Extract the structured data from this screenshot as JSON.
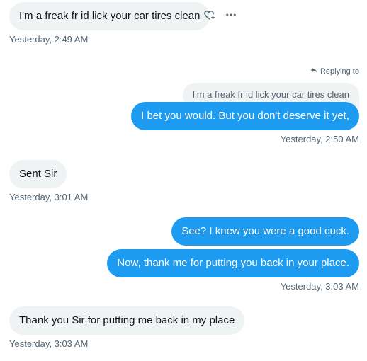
{
  "messages": [
    {
      "text": "I'm a freak fr id lick your car tires clean",
      "time": "Yesterday, 2:49 AM"
    },
    {
      "replying_label": "Replying to",
      "quoted": "I'm a freak fr id lick your car tires clean",
      "text": "I bet you would. But you don't deserve it yet,",
      "time": "Yesterday, 2:50 AM"
    },
    {
      "text": "Sent Sir",
      "time": "Yesterday, 3:01 AM"
    },
    {
      "text": "See? I knew you were a good cuck.",
      "time": ""
    },
    {
      "text": "Now, thank me for putting you back in your place.",
      "time": "Yesterday, 3:03 AM"
    },
    {
      "text": "Thank you Sir for putting me back in my place",
      "time": "Yesterday, 3:03 AM"
    }
  ],
  "icons": {
    "react": "heart-plus-icon",
    "more": "more-icon",
    "reply": "reply-arrow-icon"
  },
  "colors": {
    "outgoing": "#1d9bf0",
    "incoming": "#eff3f4",
    "muted": "#536471"
  }
}
